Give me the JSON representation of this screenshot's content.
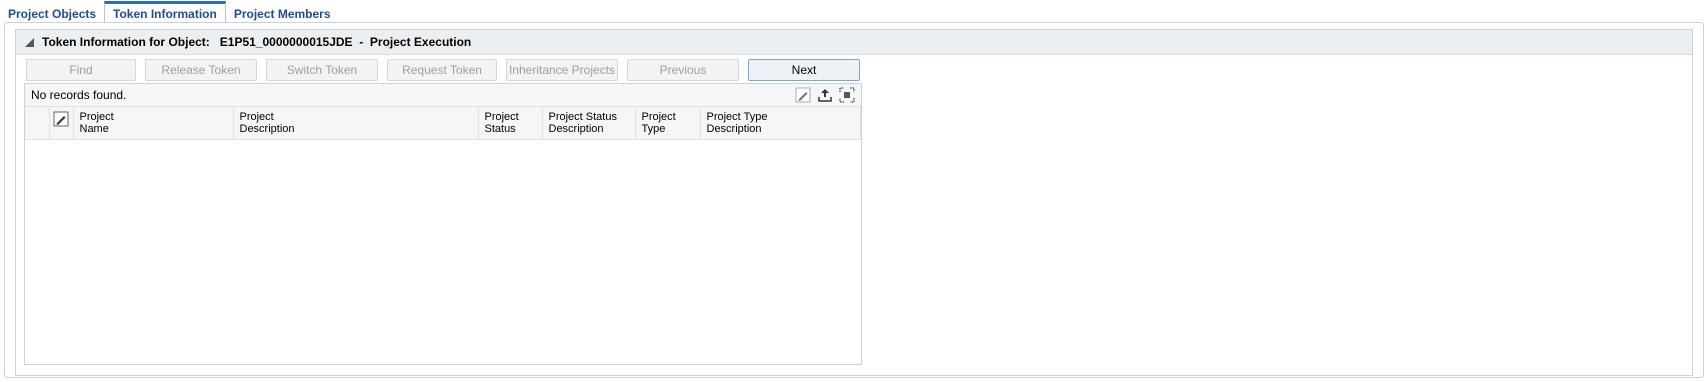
{
  "tabs": [
    {
      "label": "Project Objects",
      "active": false
    },
    {
      "label": "Token Information",
      "active": true
    },
    {
      "label": "Project Members",
      "active": false
    }
  ],
  "panel": {
    "title": "Token Information for Object:   E1P51_0000000015JDE  -  Project Execution"
  },
  "toolbar": {
    "find": "Find",
    "release_token": "Release Token",
    "switch_token": "Switch Token",
    "request_token": "Request Token",
    "inheritance_projects": "Inheritance Projects",
    "previous": "Previous",
    "next": "Next"
  },
  "grid": {
    "status_text": "No records found.",
    "columns": [
      {
        "line1": "Project",
        "line2": "Name"
      },
      {
        "line1": "Project",
        "line2": "Description"
      },
      {
        "line1": "Project",
        "line2": "Status"
      },
      {
        "line1": "Project Status",
        "line2": "Description"
      },
      {
        "line1": "Project",
        "line2": "Type"
      },
      {
        "line1": "Project Type",
        "line2": "Description"
      }
    ],
    "icons": [
      "edit-icon",
      "export-icon",
      "fullscreen-icon"
    ]
  }
}
